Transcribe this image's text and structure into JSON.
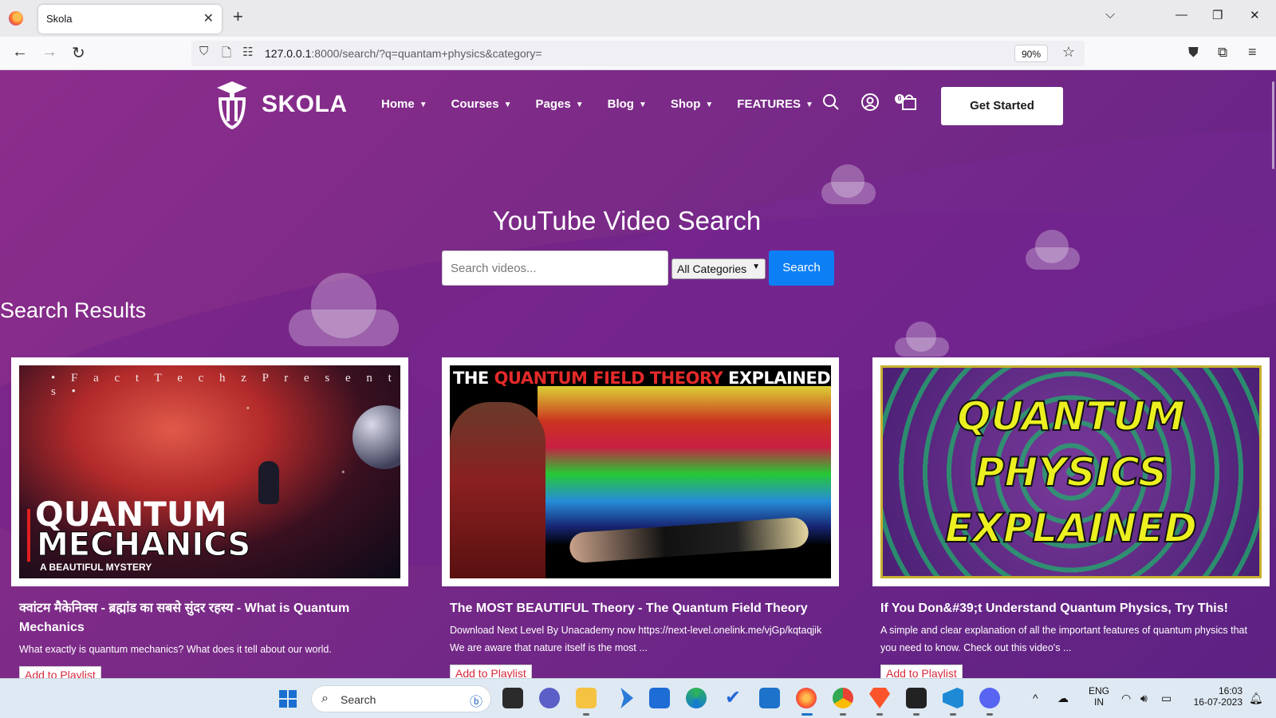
{
  "browser": {
    "tab_title": "Skola",
    "tab_close": "✕",
    "new_tab": "+",
    "url_host": "127.0.0.1",
    "url_rest": ":8000/search/?q=quantam+physics&category=",
    "zoom": "90%"
  },
  "site": {
    "brand": "SKOLA",
    "menu": [
      {
        "label": "Home"
      },
      {
        "label": "Courses"
      },
      {
        "label": "Pages"
      },
      {
        "label": "Blog"
      },
      {
        "label": "Shop"
      },
      {
        "label": "FEATURES"
      }
    ],
    "cart_count": "0",
    "cta": "Get Started"
  },
  "search": {
    "title": "YouTube Video Search",
    "placeholder": "Search videos...",
    "category": "All Categories",
    "button": "Search"
  },
  "results": {
    "heading": "Search Results",
    "add_label": "Add to Playlist",
    "videos": [
      {
        "title": "क्वांटम मैकेनिक्स - ब्रह्मांड का सबसे सुंदर रहस्य - What is Quantum Mechanics",
        "description": "What exactly is quantum mechanics? What does it tell about our world.",
        "thumb": {
          "line1": "• F a c t T e c h z  P r e s e n t s •",
          "line2": "QUANTUM",
          "line3": "MECHANICS",
          "line4": "A BEAUTIFUL MYSTERY"
        }
      },
      {
        "title": "The MOST BEAUTIFUL Theory - The Quantum Field Theory",
        "description": "Download Next Level By Unacademy now https://next-level.onelink.me/vjGp/kqtaqjik We are aware that nature itself is the most ...",
        "thumb": {
          "pre": "THE ",
          "highlight": "QUANTUM FIELD THEORY",
          "post": " EXPLAINED"
        }
      },
      {
        "title": "If You Don&#39;t Understand Quantum Physics, Try This!",
        "description": "A simple and clear explanation of all the important features of quantum physics that you need to know. Check out this video's ...",
        "thumb": {
          "line1": "QUANTUM",
          "line2": "PHYSICS",
          "line3": "EXPLAINED"
        }
      }
    ]
  },
  "taskbar": {
    "search_label": "Search",
    "lang_line1": "ENG",
    "lang_line2": "IN",
    "time": "16:03",
    "date": "16-07-2023"
  },
  "colors": {
    "page_bg": "#7a2a87",
    "search_button": "#0d7ff5",
    "playlist_text": "#d6293e"
  }
}
